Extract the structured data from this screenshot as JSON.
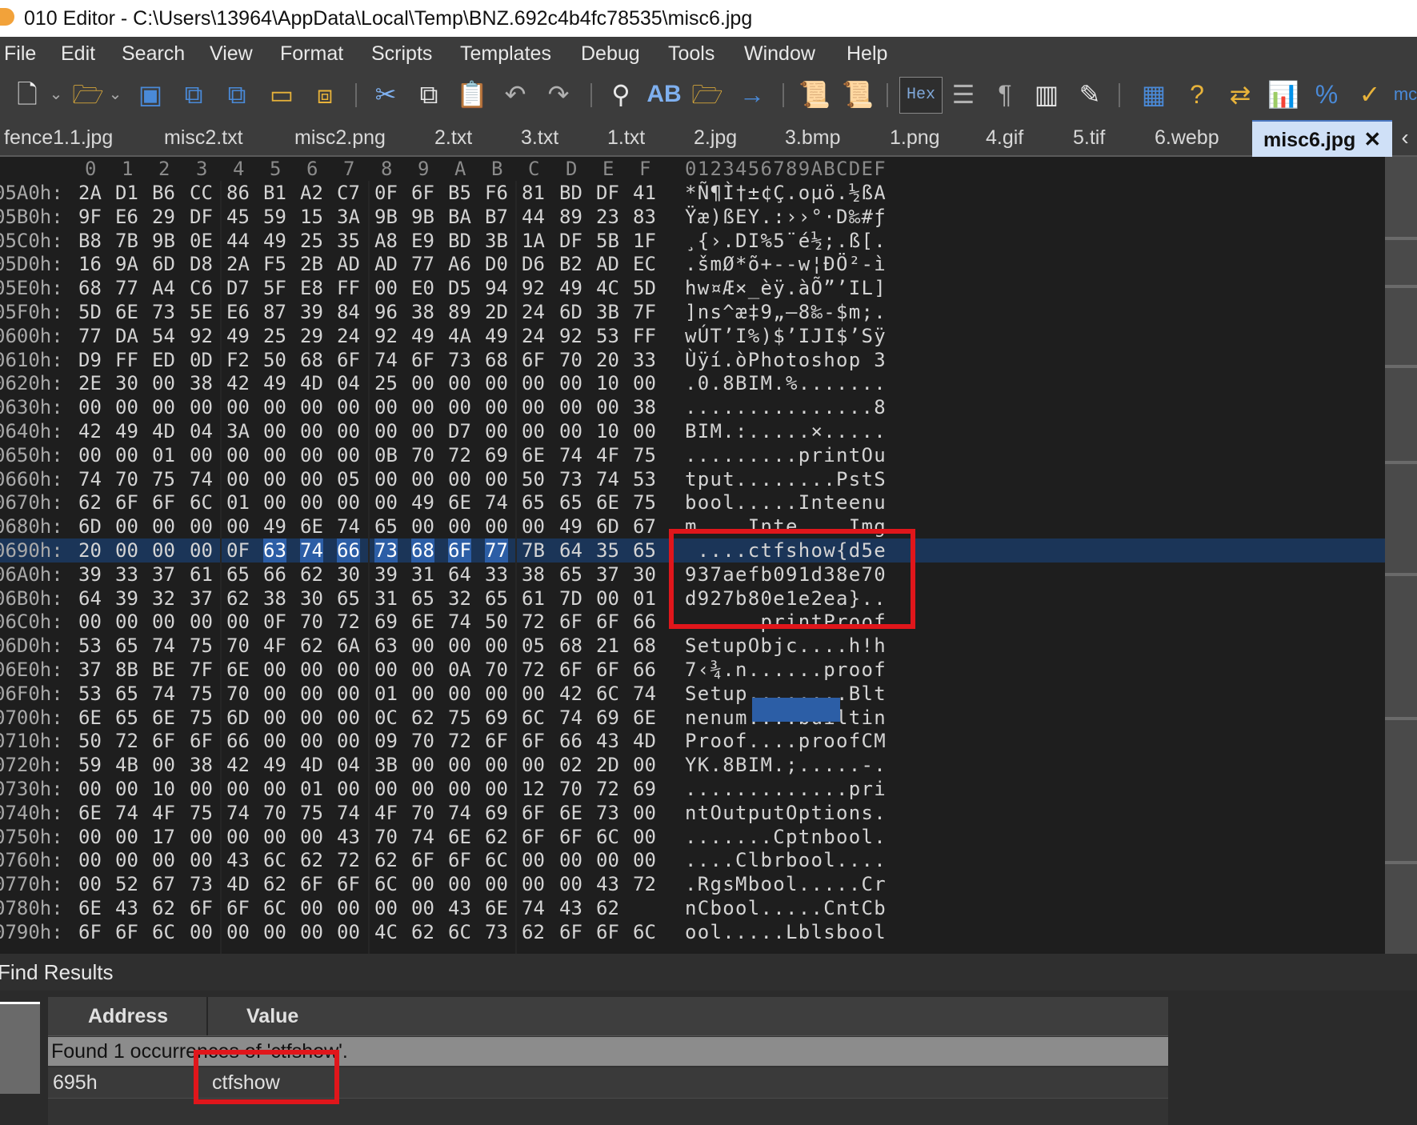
{
  "window": {
    "title": "010 Editor - C:\\Users\\13964\\AppData\\Local\\Temp\\BNZ.692c4b4fc78535\\misc6.jpg"
  },
  "menu": [
    "File",
    "Edit",
    "Search",
    "View",
    "Format",
    "Scripts",
    "Templates",
    "Debug",
    "Tools",
    "Window",
    "Help"
  ],
  "toolbar": {
    "hex_label": "Hex",
    "icons": [
      "new-file-icon",
      "open-folder-icon",
      "save-icon",
      "save-as-icon",
      "save-all-icon",
      "open-workspace-icon",
      "workspace-icon",
      "cut-icon",
      "copy-icon",
      "paste-icon",
      "undo-icon",
      "redo-icon",
      "find-icon",
      "replace-icon",
      "find-in-files-icon",
      "goto-icon",
      "run-script-icon",
      "run-template-icon",
      "hex-mode-icon",
      "word-wrap-icon",
      "pilcrow-icon",
      "columns-icon",
      "highlight-icon",
      "calculator-icon",
      "inspector-icon",
      "compare-icon",
      "histogram-icon",
      "percent-icon",
      "checksum-icon"
    ],
    "overflow_text": "mc"
  },
  "tabs": [
    "fence1.1.jpg",
    "misc2.txt",
    "misc2.png",
    "2.txt",
    "3.txt",
    "1.txt",
    "2.jpg",
    "3.bmp",
    "1.png",
    "4.gif",
    "5.tif",
    "6.webp",
    "misc6.jpg"
  ],
  "active_tab": "misc6.jpg",
  "hex": {
    "col_headers": [
      "0",
      "1",
      "2",
      "3",
      "4",
      "5",
      "6",
      "7",
      "8",
      "9",
      "A",
      "B",
      "C",
      "D",
      "E",
      "F"
    ],
    "ascii_header": "0123456789ABCDEF",
    "rows": [
      {
        "addr": "05A0h:",
        "bytes": [
          "2A",
          "D1",
          "B6",
          "CC",
          "86",
          "B1",
          "A2",
          "C7",
          "0F",
          "6F",
          "B5",
          "F6",
          "81",
          "BD",
          "DF",
          "41"
        ],
        "ascii": "*Ñ¶Ì†±¢Ç.oµö.½ßA"
      },
      {
        "addr": "05B0h:",
        "bytes": [
          "9F",
          "E6",
          "29",
          "DF",
          "45",
          "59",
          "15",
          "3A",
          "9B",
          "9B",
          "BA",
          "B7",
          "44",
          "89",
          "23",
          "83"
        ],
        "ascii": "Ÿæ)ßEY.:››°·D‰#ƒ"
      },
      {
        "addr": "05C0h:",
        "bytes": [
          "B8",
          "7B",
          "9B",
          "0E",
          "44",
          "49",
          "25",
          "35",
          "A8",
          "E9",
          "BD",
          "3B",
          "1A",
          "DF",
          "5B",
          "1F"
        ],
        "ascii": "¸{›.DI%5¨é½;.ß[."
      },
      {
        "addr": "05D0h:",
        "bytes": [
          "16",
          "9A",
          "6D",
          "D8",
          "2A",
          "F5",
          "2B",
          "AD",
          "AD",
          "77",
          "A6",
          "D0",
          "D6",
          "B2",
          "AD",
          "EC"
        ],
        "ascii": ".šmØ*õ+--w¦ĐÖ²-ì"
      },
      {
        "addr": "05E0h:",
        "bytes": [
          "68",
          "77",
          "A4",
          "C6",
          "D7",
          "5F",
          "E8",
          "FF",
          "00",
          "E0",
          "D5",
          "94",
          "92",
          "49",
          "4C",
          "5D"
        ],
        "ascii": "hw¤Æ×_èÿ.àÕ”’IL]"
      },
      {
        "addr": "05F0h:",
        "bytes": [
          "5D",
          "6E",
          "73",
          "5E",
          "E6",
          "87",
          "39",
          "84",
          "96",
          "38",
          "89",
          "2D",
          "24",
          "6D",
          "3B",
          "7F"
        ],
        "ascii": "]ns^æ‡9„–8‰-$m;."
      },
      {
        "addr": "0600h:",
        "bytes": [
          "77",
          "DA",
          "54",
          "92",
          "49",
          "25",
          "29",
          "24",
          "92",
          "49",
          "4A",
          "49",
          "24",
          "92",
          "53",
          "FF"
        ],
        "ascii": "wÚT’I%)$’IJI$’Sÿ"
      },
      {
        "addr": "0610h:",
        "bytes": [
          "D9",
          "FF",
          "ED",
          "0D",
          "F2",
          "50",
          "68",
          "6F",
          "74",
          "6F",
          "73",
          "68",
          "6F",
          "70",
          "20",
          "33"
        ],
        "ascii": "Ùÿí.òPhotoshop 3"
      },
      {
        "addr": "0620h:",
        "bytes": [
          "2E",
          "30",
          "00",
          "38",
          "42",
          "49",
          "4D",
          "04",
          "25",
          "00",
          "00",
          "00",
          "00",
          "00",
          "10",
          "00"
        ],
        "ascii": ".0.8BIM.%......."
      },
      {
        "addr": "0630h:",
        "bytes": [
          "00",
          "00",
          "00",
          "00",
          "00",
          "00",
          "00",
          "00",
          "00",
          "00",
          "00",
          "00",
          "00",
          "00",
          "00",
          "38"
        ],
        "ascii": "...............8"
      },
      {
        "addr": "0640h:",
        "bytes": [
          "42",
          "49",
          "4D",
          "04",
          "3A",
          "00",
          "00",
          "00",
          "00",
          "00",
          "D7",
          "00",
          "00",
          "00",
          "10",
          "00"
        ],
        "ascii": "BIM.:.....×....."
      },
      {
        "addr": "0650h:",
        "bytes": [
          "00",
          "00",
          "01",
          "00",
          "00",
          "00",
          "00",
          "00",
          "0B",
          "70",
          "72",
          "69",
          "6E",
          "74",
          "4F",
          "75"
        ],
        "ascii": ".........printOu"
      },
      {
        "addr": "0660h:",
        "bytes": [
          "74",
          "70",
          "75",
          "74",
          "00",
          "00",
          "00",
          "05",
          "00",
          "00",
          "00",
          "00",
          "50",
          "73",
          "74",
          "53"
        ],
        "ascii": "tput........PstS"
      },
      {
        "addr": "0670h:",
        "bytes": [
          "62",
          "6F",
          "6F",
          "6C",
          "01",
          "00",
          "00",
          "00",
          "00",
          "49",
          "6E",
          "74",
          "65",
          "65",
          "6E",
          "75"
        ],
        "ascii": "bool.....Inteenu"
      },
      {
        "addr": "0680h:",
        "bytes": [
          "6D",
          "00",
          "00",
          "00",
          "00",
          "49",
          "6E",
          "74",
          "65",
          "00",
          "00",
          "00",
          "00",
          "49",
          "6D",
          "67"
        ],
        "ascii": "m....Inte....Img"
      },
      {
        "addr": "0690h:",
        "bytes": [
          "20",
          "00",
          "00",
          "00",
          "0F",
          "63",
          "74",
          "66",
          "73",
          "68",
          "6F",
          "77",
          "7B",
          "64",
          "35",
          "65"
        ],
        "ascii": " ....ctfshow{d5e"
      },
      {
        "addr": "06A0h:",
        "bytes": [
          "39",
          "33",
          "37",
          "61",
          "65",
          "66",
          "62",
          "30",
          "39",
          "31",
          "64",
          "33",
          "38",
          "65",
          "37",
          "30"
        ],
        "ascii": "937aefb091d38e70"
      },
      {
        "addr": "06B0h:",
        "bytes": [
          "64",
          "39",
          "32",
          "37",
          "62",
          "38",
          "30",
          "65",
          "31",
          "65",
          "32",
          "65",
          "61",
          "7D",
          "00",
          "01"
        ],
        "ascii": "d927b80e1e2ea}.."
      },
      {
        "addr": "06C0h:",
        "bytes": [
          "00",
          "00",
          "00",
          "00",
          "00",
          "0F",
          "70",
          "72",
          "69",
          "6E",
          "74",
          "50",
          "72",
          "6F",
          "6F",
          "66"
        ],
        "ascii": "......printProof"
      },
      {
        "addr": "06D0h:",
        "bytes": [
          "53",
          "65",
          "74",
          "75",
          "70",
          "4F",
          "62",
          "6A",
          "63",
          "00",
          "00",
          "00",
          "05",
          "68",
          "21",
          "68"
        ],
        "ascii": "SetupObjc....h!h"
      },
      {
        "addr": "06E0h:",
        "bytes": [
          "37",
          "8B",
          "BE",
          "7F",
          "6E",
          "00",
          "00",
          "00",
          "00",
          "00",
          "0A",
          "70",
          "72",
          "6F",
          "6F",
          "66"
        ],
        "ascii": "7‹¾.n......proof"
      },
      {
        "addr": "06F0h:",
        "bytes": [
          "53",
          "65",
          "74",
          "75",
          "70",
          "00",
          "00",
          "00",
          "01",
          "00",
          "00",
          "00",
          "00",
          "42",
          "6C",
          "74"
        ],
        "ascii": "Setup........Blt"
      },
      {
        "addr": "0700h:",
        "bytes": [
          "6E",
          "65",
          "6E",
          "75",
          "6D",
          "00",
          "00",
          "00",
          "0C",
          "62",
          "75",
          "69",
          "6C",
          "74",
          "69",
          "6E"
        ],
        "ascii": "nenum....builtin"
      },
      {
        "addr": "0710h:",
        "bytes": [
          "50",
          "72",
          "6F",
          "6F",
          "66",
          "00",
          "00",
          "00",
          "09",
          "70",
          "72",
          "6F",
          "6F",
          "66",
          "43",
          "4D"
        ],
        "ascii": "Proof....proofCM"
      },
      {
        "addr": "0720h:",
        "bytes": [
          "59",
          "4B",
          "00",
          "38",
          "42",
          "49",
          "4D",
          "04",
          "3B",
          "00",
          "00",
          "00",
          "00",
          "02",
          "2D",
          "00"
        ],
        "ascii": "YK.8BIM.;.....-."
      },
      {
        "addr": "0730h:",
        "bytes": [
          "00",
          "00",
          "10",
          "00",
          "00",
          "00",
          "01",
          "00",
          "00",
          "00",
          "00",
          "00",
          "12",
          "70",
          "72",
          "69"
        ],
        "ascii": ".............pri"
      },
      {
        "addr": "0740h:",
        "bytes": [
          "6E",
          "74",
          "4F",
          "75",
          "74",
          "70",
          "75",
          "74",
          "4F",
          "70",
          "74",
          "69",
          "6F",
          "6E",
          "73",
          "00"
        ],
        "ascii": "ntOutputOptions."
      },
      {
        "addr": "0750h:",
        "bytes": [
          "00",
          "00",
          "17",
          "00",
          "00",
          "00",
          "00",
          "43",
          "70",
          "74",
          "6E",
          "62",
          "6F",
          "6F",
          "6C",
          "00"
        ],
        "ascii": ".......Cptnbool."
      },
      {
        "addr": "0760h:",
        "bytes": [
          "00",
          "00",
          "00",
          "00",
          "43",
          "6C",
          "62",
          "72",
          "62",
          "6F",
          "6F",
          "6C",
          "00",
          "00",
          "00",
          "00"
        ],
        "ascii": "....Clbrbool...."
      },
      {
        "addr": "0770h:",
        "bytes": [
          "00",
          "52",
          "67",
          "73",
          "4D",
          "62",
          "6F",
          "6F",
          "6C",
          "00",
          "00",
          "00",
          "00",
          "00",
          "43",
          "72"
        ],
        "ascii": ".RgsMbool.....Cr"
      },
      {
        "addr": "0780h:",
        "bytes": [
          "6E",
          "43",
          "62",
          "6F",
          "6F",
          "6C",
          "00",
          "00",
          "00",
          "00",
          "43",
          "6E",
          "74",
          "43",
          "62"
        ],
        "ascii": "nCbool.....CntCb"
      },
      {
        "addr": "0790h:",
        "bytes": [
          "6F",
          "6F",
          "6C",
          "00",
          "00",
          "00",
          "00",
          "00",
          "4C",
          "62",
          "6C",
          "73",
          "62",
          "6F",
          "6F",
          "6C"
        ],
        "ascii": "ool.....Lblsbool"
      }
    ]
  },
  "find": {
    "title": "Find Results",
    "col_address": "Address",
    "col_value": "Value",
    "summary": "Found 1 occurrences of 'ctfshow'.",
    "results": [
      {
        "address": "695h",
        "value": "ctfshow"
      }
    ]
  },
  "colors": {
    "selection": "#2c5ea6",
    "annotation_red": "#e0161b",
    "active_tab": "#cfe0f7"
  }
}
